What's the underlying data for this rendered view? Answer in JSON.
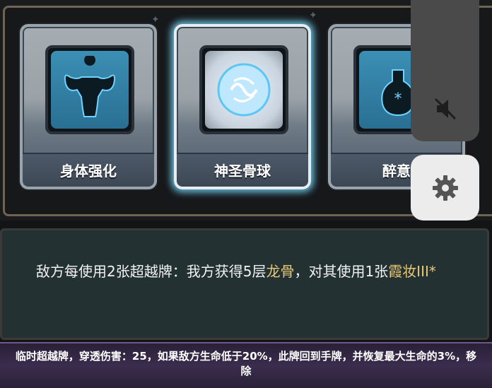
{
  "cards": [
    {
      "name": "身体强化",
      "icon": "muscle-body-icon",
      "selected": false
    },
    {
      "name": "神圣骨球",
      "icon": "holy-bone-orb-icon",
      "selected": true
    },
    {
      "name": "醉意",
      "icon": "potion-icon",
      "selected": false
    }
  ],
  "description": {
    "part1": "敌方每使用2张超越牌：我方获得5层",
    "highlight1": "龙骨",
    "part2": "，对其使用1张",
    "highlight2": "霞妆III*"
  },
  "footer": {
    "text": "临时超越牌，穿透伤害：25，如果敌方生命低于20%，此牌回到手牌，并恢复最大生命的3%，移除"
  },
  "overlay": {
    "mute_icon": "volume-muted-icon",
    "gear_icon": "gear-icon"
  },
  "colors": {
    "highlight": "#e9c873",
    "selected_glow": "#78dcff"
  }
}
